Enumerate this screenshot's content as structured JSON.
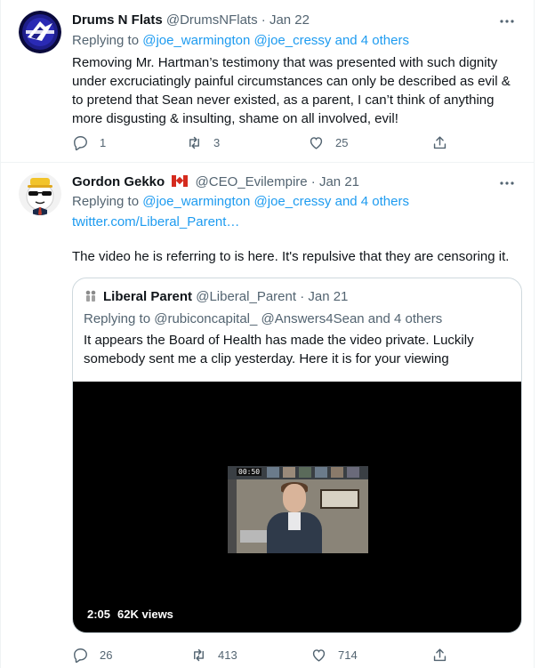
{
  "tweet1": {
    "author_name": "Drums N Flats",
    "handle": "@DrumsNFlats",
    "separator": "·",
    "date": "Jan 22",
    "more_icon": "more-dots-icon",
    "replying_prefix": "Replying to ",
    "replying_mentions": "@joe_warmington @joe_cressy and 4 others",
    "text": "Removing Mr. Hartman’s testimony that was presented with such dignity under excruciatingly painful circumstances can only be described as evil & to pretend that Sean never existed, as a parent, I can’t think of anything more disgusting & insulting, shame on all involved, evil!",
    "actions": {
      "replies": "1",
      "retweets": "3",
      "likes": "25"
    }
  },
  "tweet2": {
    "author_name": "Gordon Gekko",
    "flag": "🇨🇦",
    "handle": "@CEO_Evilempire",
    "separator": "·",
    "date": "Jan 21",
    "more_icon": "more-dots-icon",
    "replying_prefix": "Replying to ",
    "replying_mentions": "@joe_warmington @joe_cressy and 4 others",
    "link": "twitter.com/Liberal_Parent…",
    "text": "The video he is referring to is here. It's repulsive that they are censoring  it.",
    "actions": {
      "replies": "26",
      "retweets": "413",
      "likes": "714"
    },
    "quote": {
      "author_name": "Liberal Parent",
      "handle": "@Liberal_Parent",
      "separator": "·",
      "date": "Jan 21",
      "replying_prefix": "Replying to ",
      "replying_mentions": "@rubiconcapital_ @Answers4Sean and 4 others",
      "text": "It appears the Board of Health has made the video private. Luckily somebody sent me a clip yesterday. Here it is for your viewing",
      "video": {
        "duration": "2:05",
        "views": "62K views",
        "timer": "00:50"
      }
    }
  },
  "colors": {
    "text": "#0f1419",
    "secondary": "#536471",
    "link": "#1d9bf0",
    "border": "#eff3f4",
    "quote_border": "#cfd9de"
  }
}
